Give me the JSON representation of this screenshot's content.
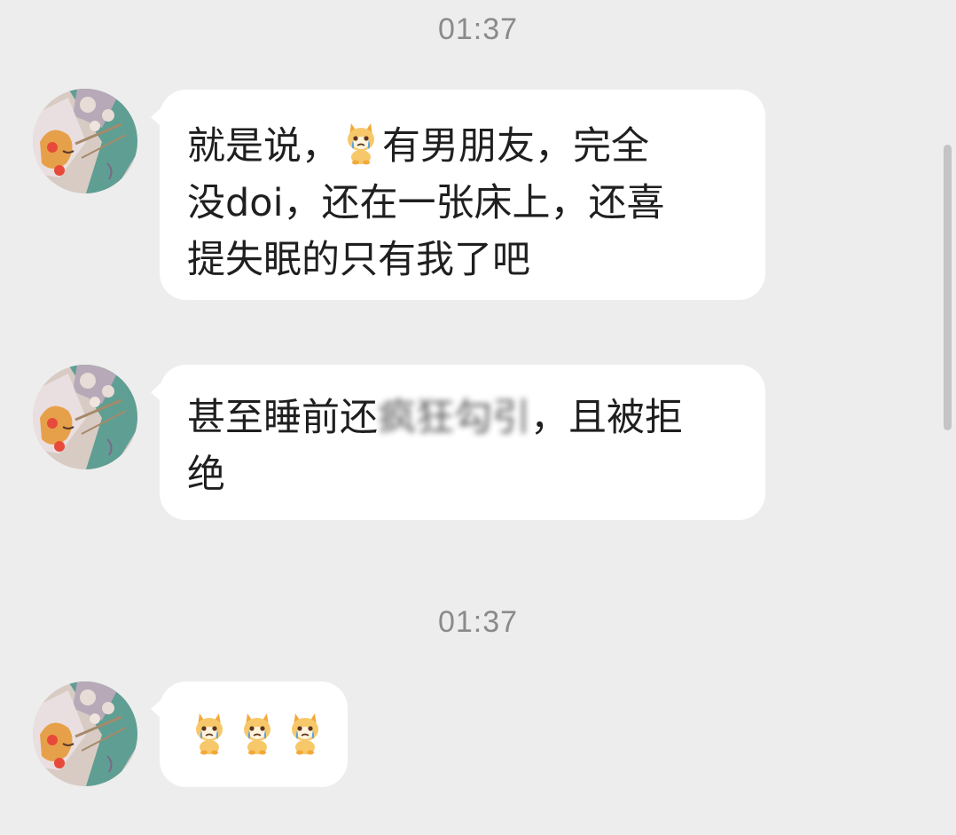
{
  "colors": {
    "background": "#ededed",
    "bubble": "#ffffff",
    "text": "#1f1f1f",
    "timestamp": "#8a8a8a",
    "scrollbar": "#c4c4c4"
  },
  "timestamps": [
    "01:37",
    "01:37"
  ],
  "messages": [
    {
      "line1_a": "就是说，",
      "line1_emoji": "crying-dog-emoji",
      "line1_b": "有男朋友，完全",
      "line2": "没doi，还在一张床上，还喜",
      "line3": "提失眠的只有我了吧"
    },
    {
      "line1_a": "甚至睡前还",
      "line1_blurred": "疯狂勾引",
      "line1_b": "，且被拒",
      "line2": "绝"
    },
    {
      "emojis": [
        "crying-dog-emoji",
        "crying-dog-emoji",
        "crying-dog-emoji"
      ]
    }
  ],
  "avatar": {
    "icon": "anime-sleeping-cat-avatar"
  }
}
